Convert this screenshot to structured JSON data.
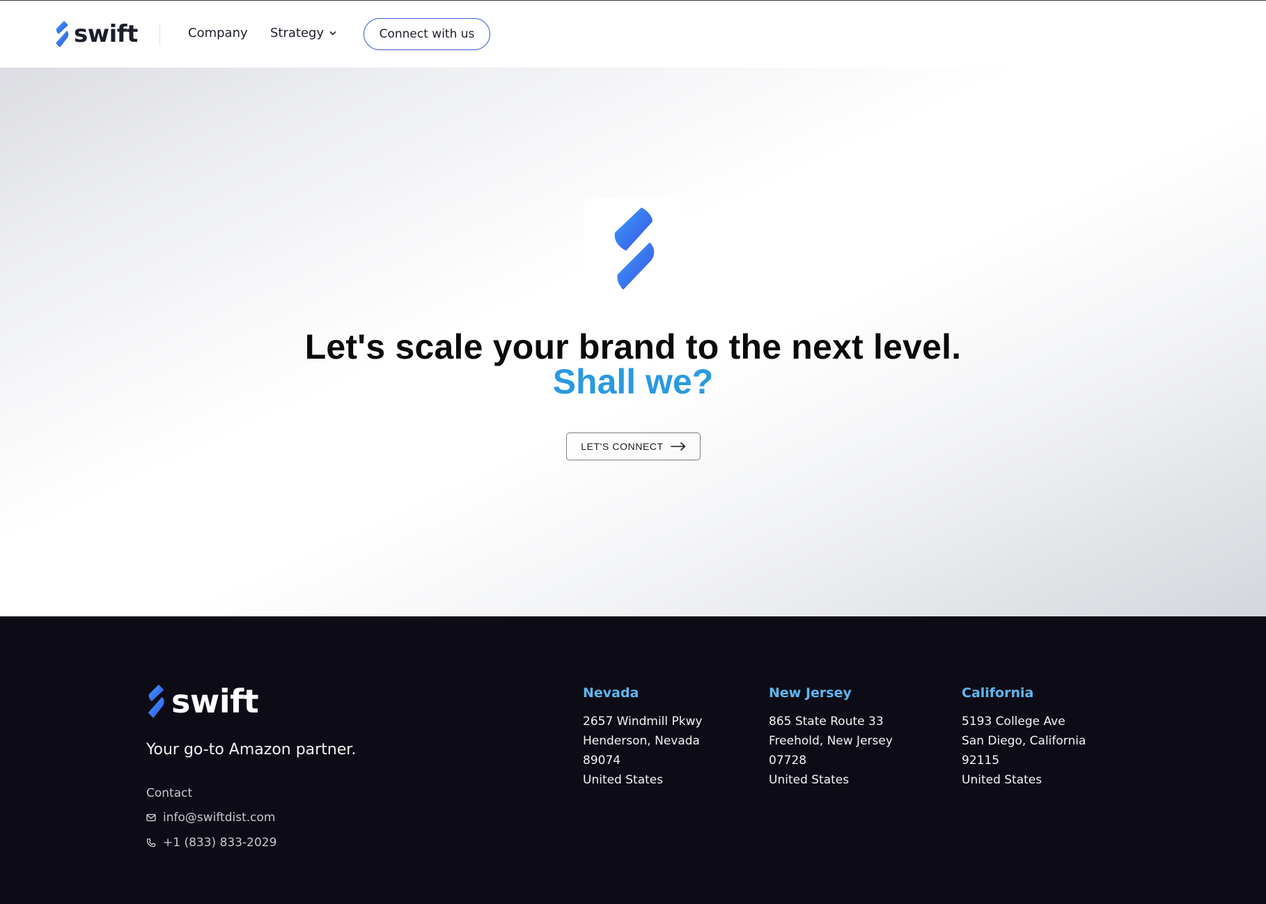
{
  "header": {
    "brand": "swift",
    "nav": {
      "company": "Company",
      "strategy": "Strategy"
    },
    "connect_label": "Connect with us"
  },
  "hero": {
    "title": "Let's scale your brand to the next level.",
    "subtitle": "Shall we?",
    "cta_label": "LET'S CONNECT"
  },
  "footer": {
    "brand": "swift",
    "tagline": "Your go-to Amazon partner.",
    "contact_label": "Contact",
    "email": "info@swiftdist.com",
    "phone": "+1 (833) 833-2029",
    "offices": [
      {
        "name": "Nevada",
        "lines": [
          "2657 Windmill Pkwy",
          "Henderson, Nevada",
          "89074",
          "United States"
        ]
      },
      {
        "name": "New Jersey",
        "lines": [
          "865 State Route 33",
          "Freehold, New Jersey",
          "07728",
          "United States"
        ]
      },
      {
        "name": "California",
        "lines": [
          "5193 College Ave",
          "San Diego, California",
          "92115",
          "United States"
        ]
      }
    ]
  },
  "icons": {
    "brand_mark": "swift-logo-icon",
    "chevron": "chevron-down-icon",
    "arrow": "arrow-right-icon",
    "mail": "mail-icon",
    "phone": "phone-icon"
  },
  "colors": {
    "accent_blue": "#3d5fd8",
    "subtitle_blue": "#2a9ae0",
    "office_title": "#5fb6ee",
    "footer_bg": "#0d0c16"
  }
}
